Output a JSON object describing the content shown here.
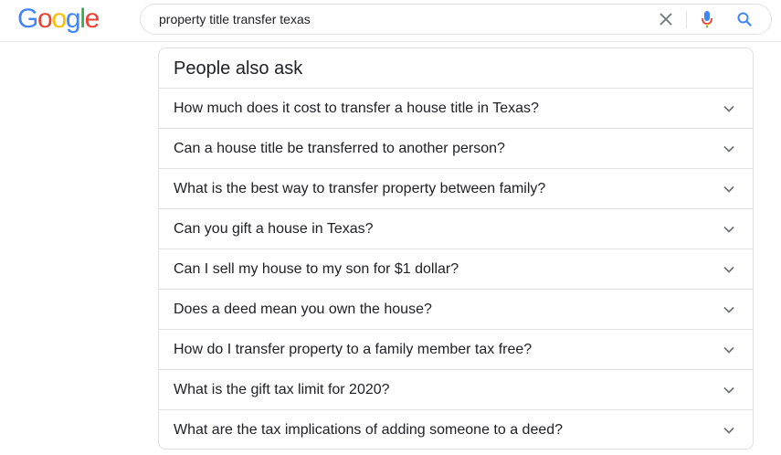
{
  "logo": {
    "letters": [
      "G",
      "o",
      "o",
      "g",
      "l",
      "e"
    ],
    "colors": [
      "#4285F4",
      "#EA4335",
      "#FBBC05",
      "#4285F4",
      "#34A853",
      "#EA4335"
    ]
  },
  "search": {
    "query": "property title transfer texas",
    "icons": {
      "clear": "close-icon",
      "voice": "mic-icon",
      "submit": "search-icon"
    }
  },
  "paa": {
    "title": "People also ask",
    "questions": [
      "How much does it cost to transfer a house title in Texas?",
      "Can a house title be transferred to another person?",
      "What is the best way to transfer property between family?",
      "Can you gift a house in Texas?",
      "Can I sell my house to my son for $1 dollar?",
      "Does a deed mean you own the house?",
      "How do I transfer property to a family member tax free?",
      "What is the gift tax limit for 2020?",
      "What are the tax implications of adding someone to a deed?"
    ]
  },
  "colors": {
    "text": "#202124",
    "icon_gray": "#70757a",
    "border": "#dfe1e5",
    "search_blue": "#4285F4"
  }
}
